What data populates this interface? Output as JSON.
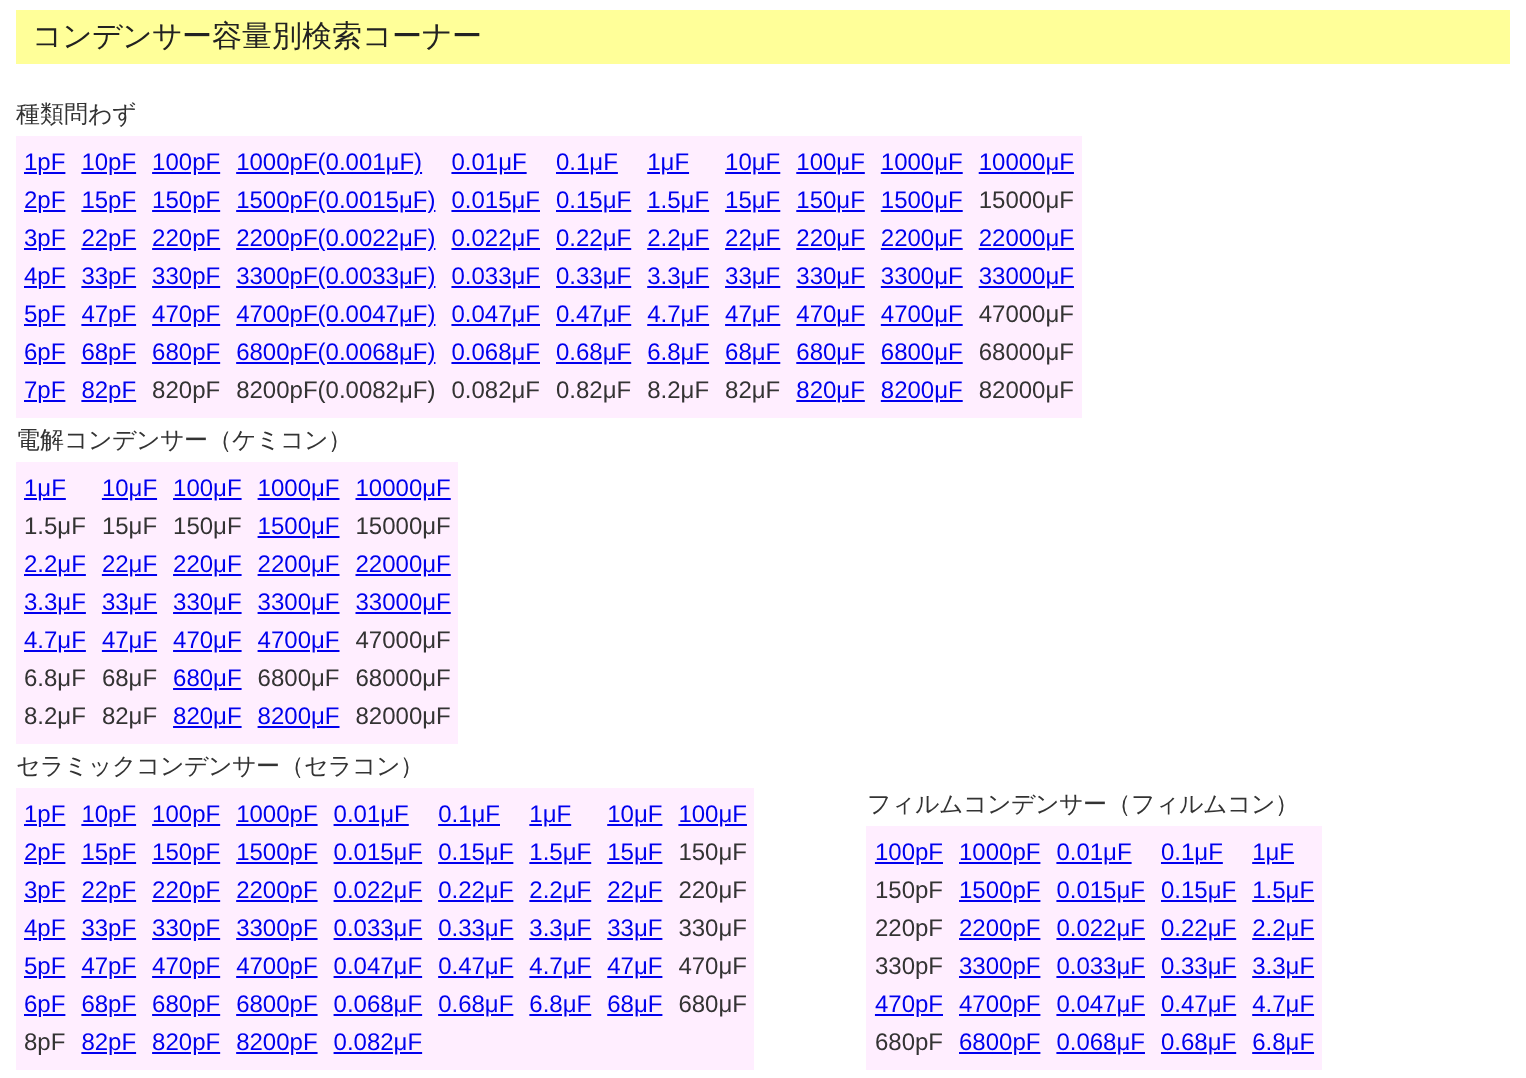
{
  "header": {
    "title": "コンデンサー容量別検索コーナー"
  },
  "sections": [
    {
      "title": "種類問わず",
      "rows": [
        [
          {
            "text": "1pF",
            "link": true
          },
          {
            "text": "10pF",
            "link": true
          },
          {
            "text": "100pF",
            "link": true
          },
          {
            "text": "1000pF(0.001μF)",
            "link": true
          },
          {
            "text": "0.01μF",
            "link": true
          },
          {
            "text": "0.1μF",
            "link": true
          },
          {
            "text": "1μF",
            "link": true
          },
          {
            "text": "10μF",
            "link": true
          },
          {
            "text": "100μF",
            "link": true
          },
          {
            "text": "1000μF",
            "link": true
          },
          {
            "text": "10000μF",
            "link": true
          }
        ],
        [
          {
            "text": "2pF",
            "link": true
          },
          {
            "text": "15pF",
            "link": true
          },
          {
            "text": "150pF",
            "link": true
          },
          {
            "text": "1500pF(0.0015μF)",
            "link": true
          },
          {
            "text": "0.015μF",
            "link": true
          },
          {
            "text": "0.15μF",
            "link": true
          },
          {
            "text": "1.5μF",
            "link": true
          },
          {
            "text": "15μF",
            "link": true
          },
          {
            "text": "150μF",
            "link": true
          },
          {
            "text": "1500μF",
            "link": true
          },
          {
            "text": "15000μF",
            "link": false
          }
        ],
        [
          {
            "text": "3pF",
            "link": true
          },
          {
            "text": "22pF",
            "link": true
          },
          {
            "text": "220pF",
            "link": true
          },
          {
            "text": "2200pF(0.0022μF)",
            "link": true
          },
          {
            "text": "0.022μF",
            "link": true
          },
          {
            "text": "0.22μF",
            "link": true
          },
          {
            "text": "2.2μF",
            "link": true
          },
          {
            "text": "22μF",
            "link": true
          },
          {
            "text": "220μF",
            "link": true
          },
          {
            "text": "2200μF",
            "link": true
          },
          {
            "text": "22000μF",
            "link": true
          }
        ],
        [
          {
            "text": "4pF",
            "link": true
          },
          {
            "text": "33pF",
            "link": true
          },
          {
            "text": "330pF",
            "link": true
          },
          {
            "text": "3300pF(0.0033μF)",
            "link": true
          },
          {
            "text": "0.033μF",
            "link": true
          },
          {
            "text": "0.33μF",
            "link": true
          },
          {
            "text": "3.3μF",
            "link": true
          },
          {
            "text": "33μF",
            "link": true
          },
          {
            "text": "330μF",
            "link": true
          },
          {
            "text": "3300μF",
            "link": true
          },
          {
            "text": "33000μF",
            "link": true
          }
        ],
        [
          {
            "text": "5pF",
            "link": true
          },
          {
            "text": "47pF",
            "link": true
          },
          {
            "text": "470pF",
            "link": true
          },
          {
            "text": "4700pF(0.0047μF)",
            "link": true
          },
          {
            "text": "0.047μF",
            "link": true
          },
          {
            "text": "0.47μF",
            "link": true
          },
          {
            "text": "4.7μF",
            "link": true
          },
          {
            "text": "47μF",
            "link": true
          },
          {
            "text": "470μF",
            "link": true
          },
          {
            "text": "4700μF",
            "link": true
          },
          {
            "text": "47000μF",
            "link": false
          }
        ],
        [
          {
            "text": "6pF",
            "link": true
          },
          {
            "text": "68pF",
            "link": true
          },
          {
            "text": "680pF",
            "link": true
          },
          {
            "text": "6800pF(0.0068μF)",
            "link": true
          },
          {
            "text": "0.068μF",
            "link": true
          },
          {
            "text": "0.68μF",
            "link": true
          },
          {
            "text": "6.8μF",
            "link": true
          },
          {
            "text": "68μF",
            "link": true
          },
          {
            "text": "680μF",
            "link": true
          },
          {
            "text": "6800μF",
            "link": true
          },
          {
            "text": "68000μF",
            "link": false
          }
        ],
        [
          {
            "text": "7pF",
            "link": true
          },
          {
            "text": "82pF",
            "link": true
          },
          {
            "text": "820pF",
            "link": false
          },
          {
            "text": "8200pF(0.0082μF)",
            "link": false
          },
          {
            "text": "0.082μF",
            "link": false
          },
          {
            "text": "0.82μF",
            "link": false
          },
          {
            "text": "8.2μF",
            "link": false
          },
          {
            "text": "82μF",
            "link": false
          },
          {
            "text": "820μF",
            "link": true
          },
          {
            "text": "8200μF",
            "link": true
          },
          {
            "text": "82000μF",
            "link": false
          }
        ]
      ]
    },
    {
      "title": "電解コンデンサー（ケミコン）",
      "rows": [
        [
          {
            "text": "1μF",
            "link": true
          },
          {
            "text": "10μF",
            "link": true
          },
          {
            "text": "100μF",
            "link": true
          },
          {
            "text": "1000μF",
            "link": true
          },
          {
            "text": "10000μF",
            "link": true
          }
        ],
        [
          {
            "text": "1.5μF",
            "link": false
          },
          {
            "text": "15μF",
            "link": false
          },
          {
            "text": "150μF",
            "link": false
          },
          {
            "text": "1500μF",
            "link": true
          },
          {
            "text": "15000μF",
            "link": false
          }
        ],
        [
          {
            "text": "2.2μF",
            "link": true
          },
          {
            "text": "22μF",
            "link": true
          },
          {
            "text": "220μF",
            "link": true
          },
          {
            "text": "2200μF",
            "link": true
          },
          {
            "text": "22000μF",
            "link": true
          }
        ],
        [
          {
            "text": "3.3μF",
            "link": true
          },
          {
            "text": "33μF",
            "link": true
          },
          {
            "text": "330μF",
            "link": true
          },
          {
            "text": "3300μF",
            "link": true
          },
          {
            "text": "33000μF",
            "link": true
          }
        ],
        [
          {
            "text": "4.7μF",
            "link": true
          },
          {
            "text": "47μF",
            "link": true
          },
          {
            "text": "470μF",
            "link": true
          },
          {
            "text": "4700μF",
            "link": true
          },
          {
            "text": "47000μF",
            "link": false
          }
        ],
        [
          {
            "text": "6.8μF",
            "link": false
          },
          {
            "text": "68μF",
            "link": false
          },
          {
            "text": "680μF",
            "link": true
          },
          {
            "text": "6800μF",
            "link": false
          },
          {
            "text": "68000μF",
            "link": false
          }
        ],
        [
          {
            "text": "8.2μF",
            "link": false
          },
          {
            "text": "82μF",
            "link": false
          },
          {
            "text": "820μF",
            "link": true
          },
          {
            "text": "8200μF",
            "link": true
          },
          {
            "text": "82000μF",
            "link": false
          }
        ]
      ]
    },
    {
      "title": "セラミックコンデンサー（セラコン）",
      "rows": [
        [
          {
            "text": "1pF",
            "link": true
          },
          {
            "text": "10pF",
            "link": true
          },
          {
            "text": "100pF",
            "link": true
          },
          {
            "text": "1000pF",
            "link": true
          },
          {
            "text": "0.01μF",
            "link": true
          },
          {
            "text": "0.1μF",
            "link": true
          },
          {
            "text": "1μF",
            "link": true
          },
          {
            "text": "10μF",
            "link": true
          },
          {
            "text": "100μF",
            "link": true
          }
        ],
        [
          {
            "text": "2pF",
            "link": true
          },
          {
            "text": "15pF",
            "link": true
          },
          {
            "text": "150pF",
            "link": true
          },
          {
            "text": "1500pF",
            "link": true
          },
          {
            "text": "0.015μF",
            "link": true
          },
          {
            "text": "0.15μF",
            "link": true
          },
          {
            "text": "1.5μF",
            "link": true
          },
          {
            "text": "15μF",
            "link": true
          },
          {
            "text": "150μF",
            "link": false
          }
        ],
        [
          {
            "text": "3pF",
            "link": true
          },
          {
            "text": "22pF",
            "link": true
          },
          {
            "text": "220pF",
            "link": true
          },
          {
            "text": "2200pF",
            "link": true
          },
          {
            "text": "0.022μF",
            "link": true
          },
          {
            "text": "0.22μF",
            "link": true
          },
          {
            "text": "2.2μF",
            "link": true
          },
          {
            "text": "22μF",
            "link": true
          },
          {
            "text": "220μF",
            "link": false
          }
        ],
        [
          {
            "text": "4pF",
            "link": true
          },
          {
            "text": "33pF",
            "link": true
          },
          {
            "text": "330pF",
            "link": true
          },
          {
            "text": "3300pF",
            "link": true
          },
          {
            "text": "0.033μF",
            "link": true
          },
          {
            "text": "0.33μF",
            "link": true
          },
          {
            "text": "3.3μF",
            "link": true
          },
          {
            "text": "33μF",
            "link": true
          },
          {
            "text": "330μF",
            "link": false
          }
        ],
        [
          {
            "text": "5pF",
            "link": true
          },
          {
            "text": "47pF",
            "link": true
          },
          {
            "text": "470pF",
            "link": true
          },
          {
            "text": "4700pF",
            "link": true
          },
          {
            "text": "0.047μF",
            "link": true
          },
          {
            "text": "0.47μF",
            "link": true
          },
          {
            "text": "4.7μF",
            "link": true
          },
          {
            "text": "47μF",
            "link": true
          },
          {
            "text": "470μF",
            "link": false
          }
        ],
        [
          {
            "text": "6pF",
            "link": true
          },
          {
            "text": "68pF",
            "link": true
          },
          {
            "text": "680pF",
            "link": true
          },
          {
            "text": "6800pF",
            "link": true
          },
          {
            "text": "0.068μF",
            "link": true
          },
          {
            "text": "0.68μF",
            "link": true
          },
          {
            "text": "6.8μF",
            "link": true
          },
          {
            "text": "68μF",
            "link": true
          },
          {
            "text": "680μF",
            "link": false
          }
        ],
        [
          {
            "text": "8pF",
            "link": false
          },
          {
            "text": "82pF",
            "link": true
          },
          {
            "text": "820pF",
            "link": true
          },
          {
            "text": "8200pF",
            "link": true
          },
          {
            "text": "0.082μF",
            "link": true
          }
        ]
      ]
    },
    {
      "title": "フィルムコンデンサー（フィルムコン）",
      "rows": [
        [
          {
            "text": "100pF",
            "link": true
          },
          {
            "text": "1000pF",
            "link": true
          },
          {
            "text": "0.01μF",
            "link": true
          },
          {
            "text": "0.1μF",
            "link": true
          },
          {
            "text": "1μF",
            "link": true
          }
        ],
        [
          {
            "text": "150pF",
            "link": false
          },
          {
            "text": "1500pF",
            "link": true
          },
          {
            "text": "0.015μF",
            "link": true
          },
          {
            "text": "0.15μF",
            "link": true
          },
          {
            "text": "1.5μF",
            "link": true
          }
        ],
        [
          {
            "text": "220pF",
            "link": false
          },
          {
            "text": "2200pF",
            "link": true
          },
          {
            "text": "0.022μF",
            "link": true
          },
          {
            "text": "0.22μF",
            "link": true
          },
          {
            "text": "2.2μF",
            "link": true
          }
        ],
        [
          {
            "text": "330pF",
            "link": false
          },
          {
            "text": "3300pF",
            "link": true
          },
          {
            "text": "0.033μF",
            "link": true
          },
          {
            "text": "0.33μF",
            "link": true
          },
          {
            "text": "3.3μF",
            "link": true
          }
        ],
        [
          {
            "text": "470pF",
            "link": true
          },
          {
            "text": "4700pF",
            "link": true
          },
          {
            "text": "0.047μF",
            "link": true
          },
          {
            "text": "0.47μF",
            "link": true
          },
          {
            "text": "4.7μF",
            "link": true
          }
        ],
        [
          {
            "text": "680pF",
            "link": false
          },
          {
            "text": "6800pF",
            "link": true
          },
          {
            "text": "0.068μF",
            "link": true
          },
          {
            "text": "0.68μF",
            "link": true
          },
          {
            "text": "6.8μF",
            "link": true
          }
        ]
      ]
    }
  ]
}
